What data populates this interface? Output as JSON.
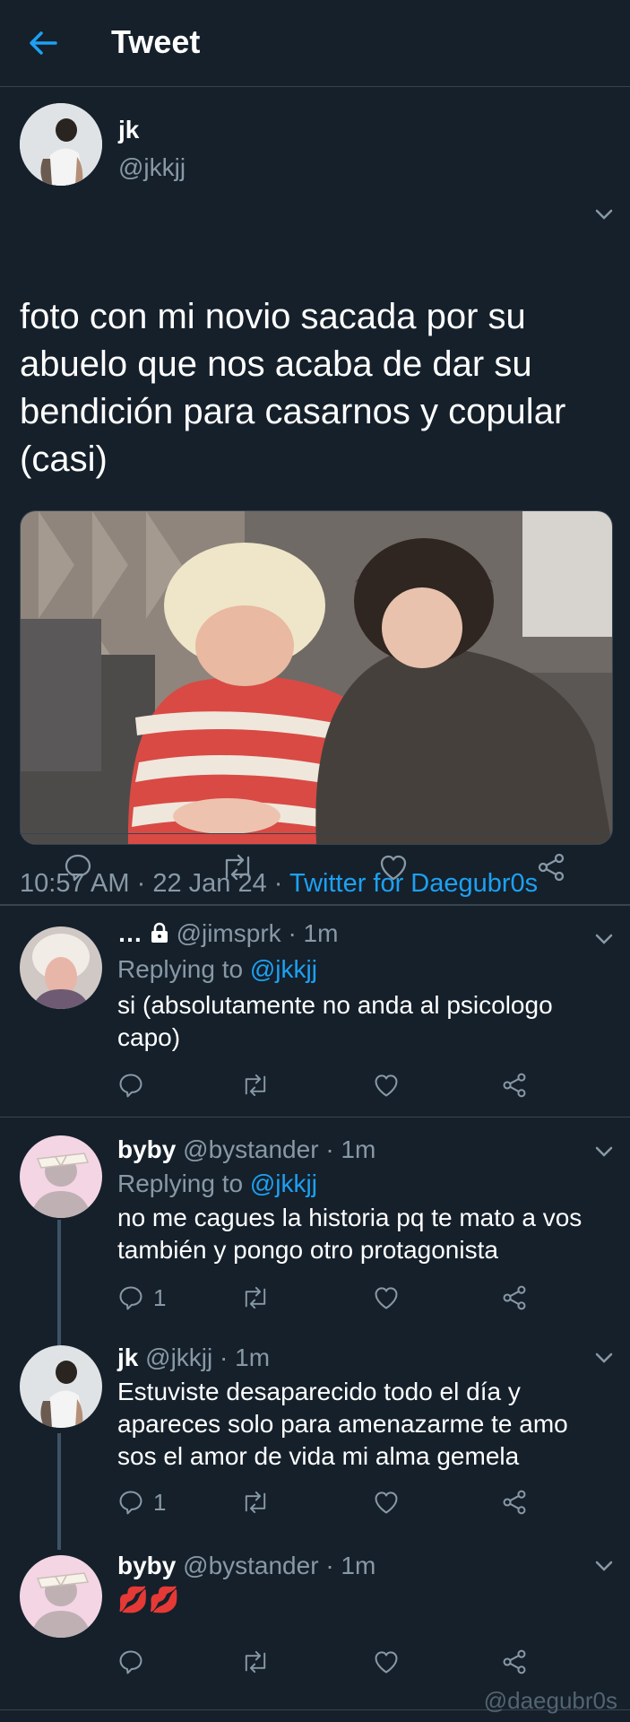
{
  "header": {
    "title": "Tweet",
    "back_icon": "arrow-left-icon",
    "accent": "#1da1f2"
  },
  "tweet": {
    "author": {
      "name": "jk",
      "handle": "@jkkjj"
    },
    "text": "foto con mi novio sacada por su abuelo que nos acaba de dar su bendición para casarnos y copular (casi)",
    "time": "10:57 AM",
    "sep1": " · ",
    "date": "22 Jan 24",
    "sep2": " · ",
    "source": "Twitter for Daegubr0s"
  },
  "replies": [
    {
      "name": "…",
      "lock_icon": "lock-icon",
      "handle": "@jimsprk",
      "age": "· 1m",
      "replying_label": "Replying to",
      "replying_to": "@jkkjj",
      "text": "si (absolutamente no anda al psicologo capo)",
      "reply_count": ""
    },
    {
      "name": "byby",
      "handle": "@bystander",
      "age": "· 1m",
      "replying_label": "Replying to",
      "replying_to": "@jkkjj",
      "text": "no me cagues la historia pq te mato a vos también y pongo otro protagonista",
      "reply_count": "1"
    },
    {
      "name": "jk",
      "handle": "@jkkjj",
      "age": "· 1m",
      "text": "Estuviste desaparecido todo el día y apareces solo para amenazarme te amo sos el amor de vida mi alma gemela",
      "reply_count": "1"
    },
    {
      "name": "byby",
      "handle": "@bystander",
      "age": "· 1m",
      "text": "💋💋",
      "reply_count": ""
    }
  ],
  "watermark": "@daegubr0s"
}
